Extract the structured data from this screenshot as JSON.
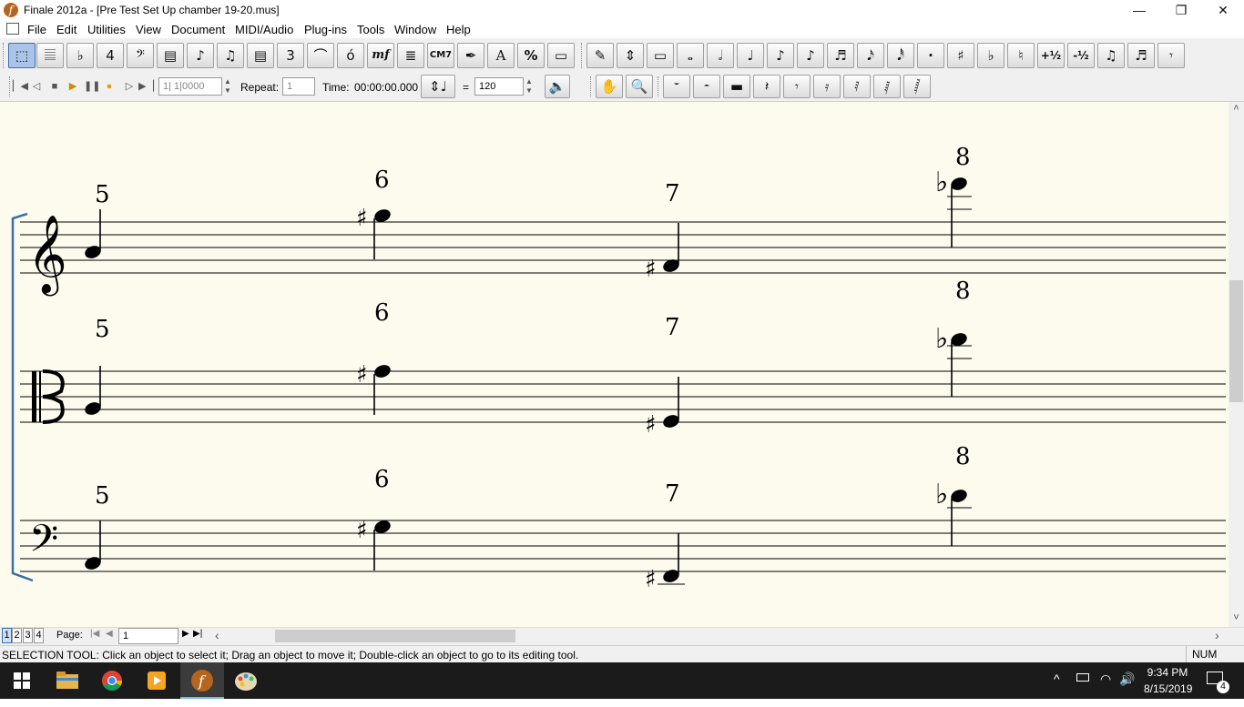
{
  "window": {
    "title": "Finale 2012a - [Pre Test Set Up chamber 19-20.mus]",
    "app_icon_glyph": "f",
    "minimize": "—",
    "maximize": "❐",
    "close": "✕"
  },
  "menus": [
    "File",
    "Edit",
    "Utilities",
    "View",
    "Document",
    "MIDI/Audio",
    "Plug-ins",
    "Tools",
    "Window",
    "Help"
  ],
  "mdi_controls": {
    "minimize": "–",
    "restore": "⧉",
    "close": "✕"
  },
  "toolbar_main": {
    "icons": [
      "selection-tool-icon",
      "staff-tool-icon",
      "key-signature-icon",
      "time-signature-icon",
      "clef-icon",
      "measure-icon",
      "simple-entry-icon",
      "speedy-entry-icon",
      "tuplet-icon",
      "smart-shape-icon",
      "articulation-icon",
      "expression-icon",
      "chord-icon",
      "lyrics-icon",
      "text-icon",
      "resize-icon",
      "page-layout-icon"
    ],
    "glyphs": [
      "⬚",
      "𝄚",
      "♭",
      "4",
      "𝄢",
      "▤",
      "♪",
      "♫",
      "3",
      "⌒",
      "ό",
      "mf",
      "≣",
      "CM7",
      "✒",
      "A",
      "%",
      "▭"
    ],
    "chord_label": "CM7",
    "expression_label": "mf",
    "text_label": "A",
    "resize_label": "%"
  },
  "toolbar_simple_entry": {
    "glyphs": [
      "✎",
      "⇕",
      "▭",
      "𝅝",
      "𝅗𝅥",
      "♩",
      "♪",
      "♬",
      "𝅘𝅥𝅯",
      "𝅘𝅥𝅰",
      "·",
      "♯",
      "♭",
      "♮",
      "+½",
      "-½",
      "♫",
      "♬",
      "𝄾"
    ],
    "raise_half_label": "+½",
    "lower_half_label": "-½"
  },
  "playback": {
    "counter_value": "1|  1|0000",
    "repeat_label": "Repeat:",
    "repeat_value": "1",
    "time_label": "Time:",
    "time_value": "00:00:00.000",
    "equals": "=",
    "tempo_value": "120"
  },
  "rest_palette": {
    "glyphs": [
      "𝄻",
      "𝄼",
      "▬",
      "𝄽",
      "𝄾",
      "𝄿",
      "𝅀",
      "𝅁",
      "𝅂"
    ]
  },
  "score": {
    "staves": [
      {
        "clef": "treble-clef",
        "clef_glyph": "𝄞",
        "measure_numbers": [
          "5",
          "6",
          "7",
          "8"
        ],
        "accidentals": [
          "",
          "♯",
          "♯",
          "♭"
        ]
      },
      {
        "clef": "alto-clef",
        "clef_glyph": "𝄡",
        "measure_numbers": [
          "5",
          "6",
          "7",
          "8"
        ],
        "accidentals": [
          "",
          "♯",
          "♯",
          "♭"
        ]
      },
      {
        "clef": "bass-clef",
        "clef_glyph": "𝄢",
        "measure_numbers": [
          "5",
          "6",
          "7",
          "8"
        ],
        "accidentals": [
          "",
          "♯",
          "♯",
          "♭"
        ]
      }
    ]
  },
  "pages": {
    "tabs": [
      "1",
      "2",
      "3",
      "4"
    ],
    "label": "Page:",
    "current": "1",
    "nav": [
      "|◀",
      "◀",
      "▶",
      "▶|"
    ],
    "left_arrow": "‹",
    "right_arrow": "›"
  },
  "vscroll": {
    "up": "˄",
    "down": "˅"
  },
  "status": {
    "message": "SELECTION TOOL: Click an object to select it; Drag an object to move it; Double-click an object to go to its editing tool.",
    "num": "NUM"
  },
  "taskbar": {
    "apps": [
      "start-icon",
      "file-explorer-icon",
      "chrome-icon",
      "media-player-icon",
      "finale-icon",
      "paint-icon"
    ],
    "time": "9:34 PM",
    "date": "8/15/2019",
    "notifications": "4"
  }
}
